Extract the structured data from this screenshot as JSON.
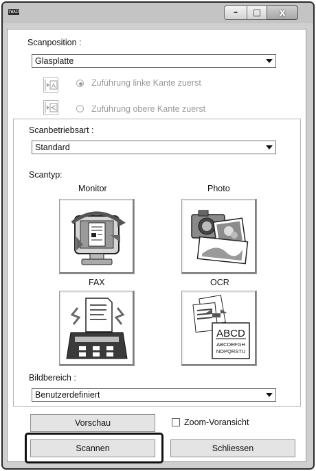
{
  "window": {
    "app_icon_text": "TWAIN",
    "minimize_glyph": "–",
    "maximize_glyph": "□",
    "close_glyph": "x"
  },
  "scan_position": {
    "label": "Scanposition :",
    "value": "Glasplatte",
    "feed_left_label": "Zuführung linke Kante zuerst",
    "feed_top_label": "Zuführung obere Kante zuerst",
    "feed_left_icon_letter": "A"
  },
  "scan_mode": {
    "label": "Scanbetriebsart :",
    "value": "Standard"
  },
  "scan_type": {
    "label": "Scantyp:",
    "items": [
      {
        "label": "Monitor",
        "icon": "monitor-icon"
      },
      {
        "label": "Photo",
        "icon": "photo-icon"
      },
      {
        "label": "FAX",
        "icon": "fax-icon"
      },
      {
        "label": "OCR",
        "icon": "ocr-icon"
      }
    ],
    "ocr_big_text": "ABCD",
    "ocr_small_text_1": "ABCDEFGH",
    "ocr_small_text_2": "NOPQRSTU"
  },
  "image_area": {
    "label": "Bildbereich :",
    "value": "Benutzerdefiniert"
  },
  "buttons": {
    "preview": "Vorschau",
    "zoom_preview": "Zoom-Voransicht",
    "scan": "Scannen",
    "close": "Schliessen"
  },
  "colors": {
    "disabled_text": "#9a9a9a",
    "highlight_border": "#111111"
  }
}
